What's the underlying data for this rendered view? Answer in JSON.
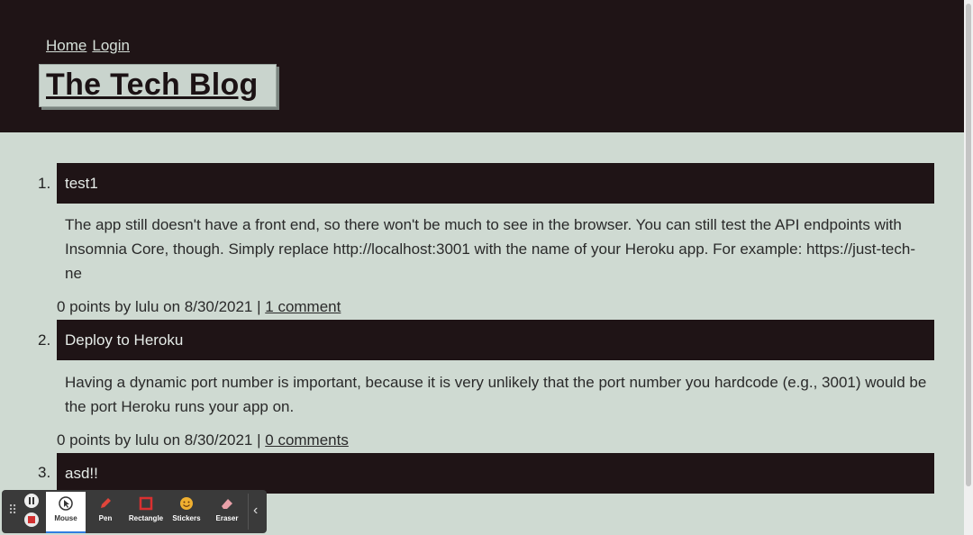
{
  "nav": {
    "home": "Home",
    "login": "Login"
  },
  "site_title": "The Tech Blog",
  "posts": [
    {
      "number": "1.",
      "title": "test1",
      "body": "The app still doesn't have a front end, so there won't be much to see in the browser. You can still test the API endpoints with Insomnia Core, though. Simply replace http://localhost:3001 with the name of your Heroku app. For example: https://just-tech-ne",
      "meta": "0 points by lulu on 8/30/2021 |",
      "comments": "1 comment"
    },
    {
      "number": "2.",
      "title": "Deploy to Heroku",
      "body": "Having a dynamic port number is important, because it is very unlikely that the port number you hardcode (e.g., 3001) would be the port Heroku runs your app on.",
      "meta": "0 points by lulu on 8/30/2021 |",
      "comments": "0 comments"
    },
    {
      "number": "3.",
      "title": "asd!!"
    }
  ],
  "toolbar": {
    "tools": [
      {
        "label": "Mouse",
        "icon": "mouse-icon"
      },
      {
        "label": "Pen",
        "icon": "pen-icon"
      },
      {
        "label": "Rectangle",
        "icon": "rectangle-icon"
      },
      {
        "label": "Stickers",
        "icon": "stickers-icon"
      },
      {
        "label": "Eraser",
        "icon": "eraser-icon"
      }
    ],
    "colors": {
      "pen": "#e0453a",
      "rectangle": "#d93030",
      "stickers": "#f0b030",
      "eraser": "#e8a0a8"
    }
  }
}
